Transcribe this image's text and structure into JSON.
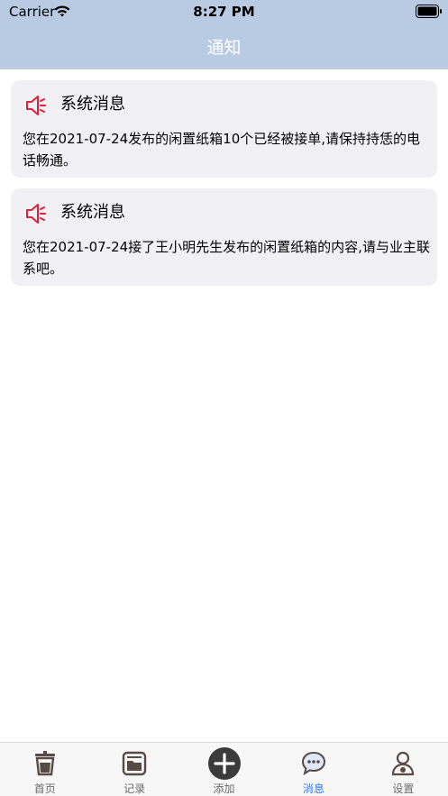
{
  "status_bar": {
    "carrier": "Carrier",
    "time": "8:27 PM"
  },
  "nav": {
    "title": "通知"
  },
  "notifications": [
    {
      "title": "系统消息",
      "body": "您在2021-07-24发布的闲置纸箱10个已经被接单,请保持持恁的电话畅通。",
      "icon": "speaker-icon"
    },
    {
      "title": "系统消息",
      "body": "您在2021-07-24接了王小明先生发布的闲置纸箱的内容,请与业主联系吧。",
      "icon": "speaker-icon"
    }
  ],
  "tabbar": {
    "items": [
      {
        "label": "首页",
        "icon": "cup-icon"
      },
      {
        "label": "记录",
        "icon": "folder-icon"
      },
      {
        "label": "添加",
        "icon": "add-icon"
      },
      {
        "label": "消息",
        "icon": "chat-icon",
        "active": true
      },
      {
        "label": "设置",
        "icon": "profile-icon"
      }
    ]
  },
  "colors": {
    "header": "#b9cbe3",
    "accent": "#2f7cf6",
    "icon_red": "#e0203c",
    "card": "#f1f1f5"
  }
}
